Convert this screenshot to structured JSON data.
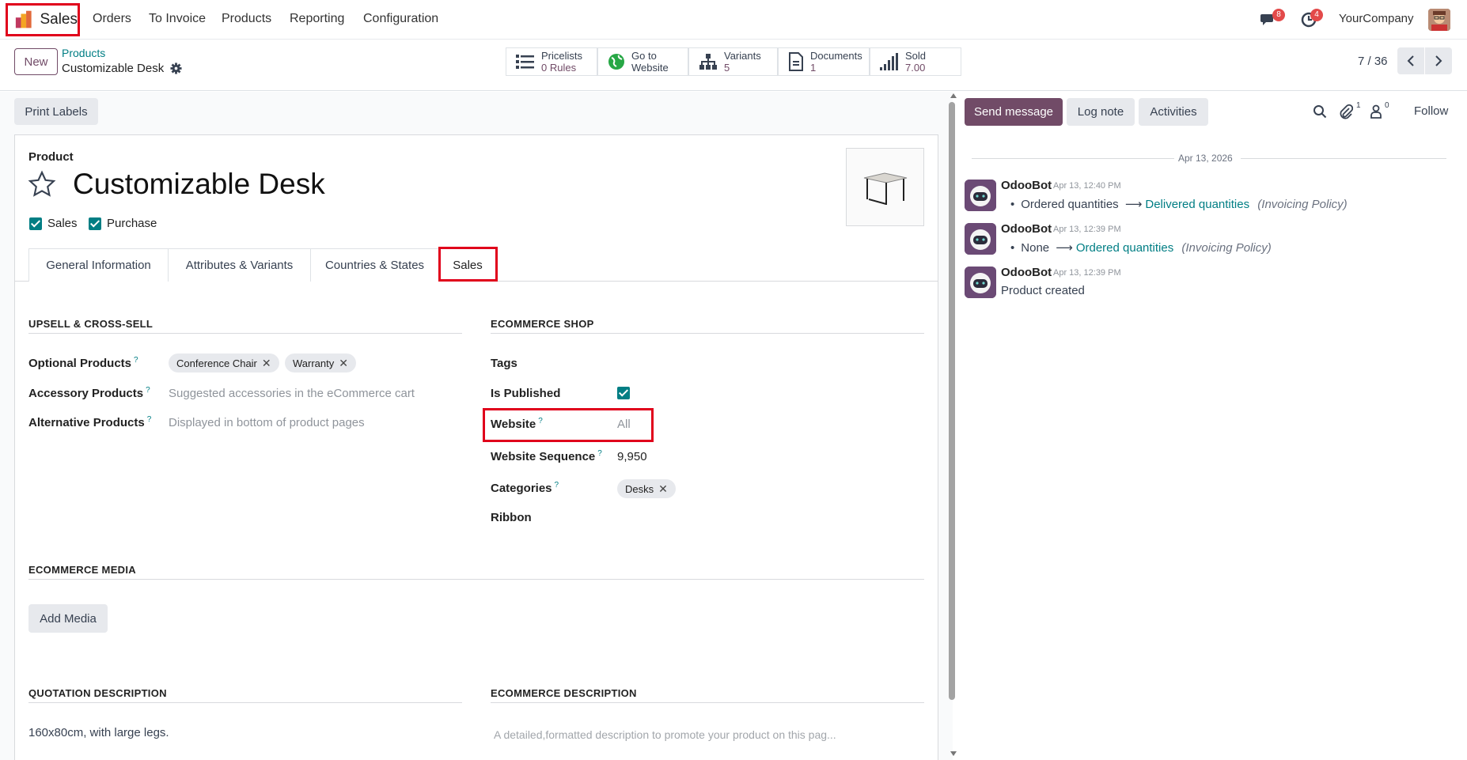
{
  "app": {
    "name": "Sales"
  },
  "nav": {
    "items": [
      "Orders",
      "To Invoice",
      "Products",
      "Reporting",
      "Configuration"
    ],
    "messages_count": "8",
    "activities_count": "4",
    "company": "YourCompany"
  },
  "control": {
    "new_label": "New",
    "breadcrumb_parent": "Products",
    "breadcrumb_current": "Customizable Desk",
    "pager": "7 / 36"
  },
  "smart_buttons": {
    "pricelists": {
      "label": "Pricelists",
      "value": "0 Rules",
      "icon": "list-icon"
    },
    "website": {
      "label": "Go to",
      "value": "Website",
      "icon": "globe-icon"
    },
    "variants": {
      "label": "Variants",
      "value": "5",
      "icon": "sitemap-icon"
    },
    "documents": {
      "label": "Documents",
      "value": "1",
      "icon": "file-icon"
    },
    "sold": {
      "label": "Sold",
      "value": "7.00",
      "icon": "signal-icon"
    }
  },
  "form": {
    "print_labels": "Print Labels",
    "product_label": "Product",
    "product_name": "Customizable Desk",
    "sales_check": "Sales",
    "purchase_check": "Purchase",
    "tabs": [
      "General Information",
      "Attributes & Variants",
      "Countries & States",
      "Sales"
    ],
    "upsell": {
      "title": "UPSELL & CROSS-SELL",
      "optional_label": "Optional Products",
      "optional_tags": [
        "Conference Chair",
        "Warranty"
      ],
      "accessory_label": "Accessory Products",
      "accessory_placeholder": "Suggested accessories in the eCommerce cart",
      "alternative_label": "Alternative Products",
      "alternative_placeholder": "Displayed in bottom of product pages"
    },
    "ecommerce_shop": {
      "title": "ECOMMERCE SHOP",
      "tags_label": "Tags",
      "published_label": "Is Published",
      "website_label": "Website",
      "website_value": "All",
      "sequence_label": "Website Sequence",
      "sequence_value": "9,950",
      "categories_label": "Categories",
      "categories_tags": [
        "Desks"
      ],
      "ribbon_label": "Ribbon"
    },
    "media": {
      "title": "ECOMMERCE MEDIA",
      "add_label": "Add Media"
    },
    "quotation": {
      "title": "QUOTATION DESCRIPTION",
      "value": "160x80cm, with large legs."
    },
    "ecommerce_desc": {
      "title": "ECOMMERCE DESCRIPTION",
      "placeholder": "A detailed,formatted description to promote your product on this pag..."
    }
  },
  "chatter": {
    "send_message": "Send message",
    "log_note": "Log note",
    "activities": "Activities",
    "attachments_count": "1",
    "followers_count": "0",
    "follow": "Follow",
    "date_separator": "Apr 13, 2026",
    "messages": [
      {
        "author": "OdooBot",
        "date": "Apr 13, 12:40 PM",
        "old": "Ordered quantities",
        "new": "Delivered quantities",
        "field": "(Invoicing Policy)"
      },
      {
        "author": "OdooBot",
        "date": "Apr 13, 12:39 PM",
        "old": "None",
        "new": "Ordered quantities",
        "field": "(Invoicing Policy)"
      },
      {
        "author": "OdooBot",
        "date": "Apr 13, 12:39 PM",
        "text": "Product created"
      }
    ]
  },
  "colors": {
    "brand": "#714b67",
    "teal": "#017e84",
    "highlight": "#e0001b"
  }
}
